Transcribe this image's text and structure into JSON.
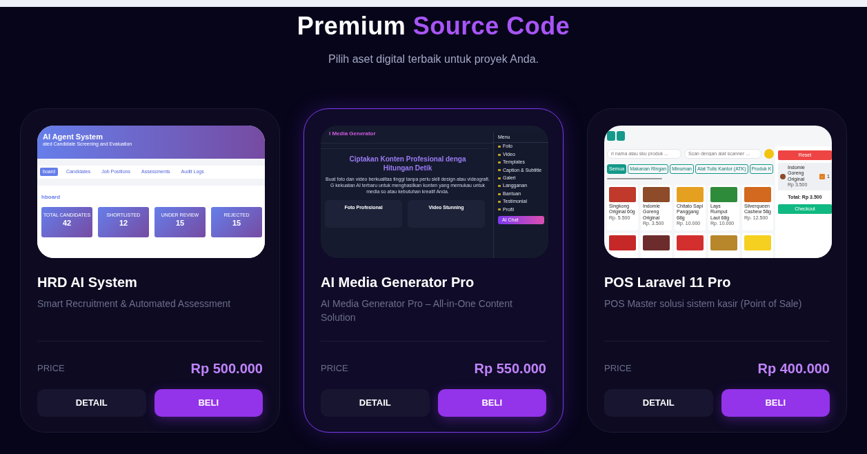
{
  "heading": {
    "parts": [
      {
        "text": "Premium",
        "accent": false
      },
      {
        "text": "Source Code",
        "accent": true
      }
    ],
    "subtitle": "Pilih aset digital terbaik untuk proyek Anda."
  },
  "products": [
    {
      "featured": false,
      "title": "HRD AI System",
      "description": "Smart Recruitment & Automated Assessment",
      "price_label": "PRICE",
      "price": "Rp 500.000",
      "detail_button": "DETAIL",
      "buy_button": "BELI",
      "preview": {
        "kind": "hrd",
        "title": "AI Agent System",
        "subtitle": "ated Candidate Screening and Evaluation",
        "tabs": [
          {
            "label": "board",
            "selected": true
          },
          {
            "label": "Candidates",
            "selected": false
          },
          {
            "label": "Job Positions",
            "selected": false
          },
          {
            "label": "Assessments",
            "selected": false
          },
          {
            "label": "Audit Logs",
            "selected": false
          }
        ],
        "section_title": "hboard",
        "stats": [
          {
            "label": "TOTAL CANDIDATES",
            "value": "42"
          },
          {
            "label": "SHORTLISTED",
            "value": "12"
          },
          {
            "label": "UNDER REVIEW",
            "value": "15"
          },
          {
            "label": "REJECTED",
            "value": "15"
          }
        ]
      }
    },
    {
      "featured": true,
      "title": "AI Media Generator Pro",
      "description": "AI Media Generator Pro – All-in-One Content Solution",
      "price_label": "PRICE",
      "price": "Rp 550.000",
      "detail_button": "DETAIL",
      "buy_button": "BELI",
      "preview": {
        "kind": "media",
        "title": "I Media Generator",
        "headline": [
          "Ciptakan Konten Profesional denga",
          "Hitungan Detik"
        ],
        "paragraph": "Buat foto dan video berkualitas tinggi tanpa perlu skill design atau videografi. G kekuatan AI terbaru untuk menghasilkan konten yang memukau untuk media so atau kebutuhan kreatif Anda.",
        "features": [
          "Foto Profesional",
          "Video Stunning"
        ],
        "menu_title": "Menu",
        "menu": [
          "Foto",
          "Video",
          "Templates",
          "Caption & Subtitle",
          "Galeri",
          "Langganan",
          "Bantuan",
          "Testimonial",
          "Profil"
        ],
        "menu_button": "AI Chat"
      }
    },
    {
      "featured": false,
      "title": "POS Laravel 11 Pro",
      "description": "POS Master solusi sistem kasir (Point of Sale)",
      "price_label": "PRICE",
      "price": "Rp 400.000",
      "detail_button": "DETAIL",
      "buy_button": "BELI",
      "preview": {
        "kind": "pos",
        "search_placeholder": "ri nama atau sku produk ...",
        "scan_placeholder": "Scan dengan alat scanner ...",
        "categories": [
          {
            "label": "Semua",
            "selected": true
          },
          {
            "label": "Makanan Ringan",
            "selected": false
          },
          {
            "label": "Minuman",
            "selected": false
          },
          {
            "label": "Alat Tulis Kantor (ATK)",
            "selected": false
          },
          {
            "label": "Produk K",
            "selected": false
          }
        ],
        "items": [
          {
            "name": "Singkong Original 60g",
            "price": "Rp. 5.500",
            "color": "#c0392b"
          },
          {
            "name": "Indomie Goreng Original",
            "price": "Rp. 3.500",
            "color": "#8d4b2a"
          },
          {
            "name": "Chitato Sapi Panggang 68g",
            "price": "Rp. 10.000",
            "color": "#e6a020"
          },
          {
            "name": "Lays Rumput Laut 68g",
            "price": "Rp. 10.000",
            "color": "#2e8b3a"
          },
          {
            "name": "Silverqueen Cashew 58g",
            "price": "Rp. 12.500",
            "color": "#d2691e"
          },
          {
            "color": "#c62828"
          },
          {
            "color": "#6d2c2c"
          },
          {
            "color": "#d32f2f"
          },
          {
            "color": "#b8862b"
          },
          {
            "color": "#f5d020"
          }
        ],
        "reset_button": "Reset",
        "cart_item": {
          "name": "Indomie Goreng Original",
          "price": "Rp 3.500",
          "qty": "1",
          "minus": "-"
        },
        "total": "Total: Rp 3.500",
        "checkout_button": "Checkout"
      }
    }
  ]
}
